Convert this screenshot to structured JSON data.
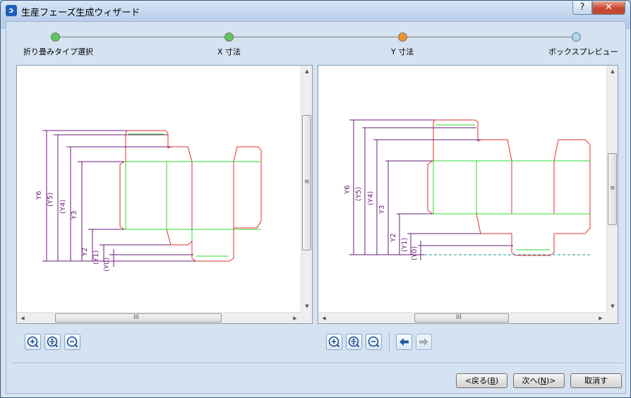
{
  "window": {
    "title": "生産フェーズ生成ウィザード",
    "help_label": "?",
    "close_label": "✕"
  },
  "steps": [
    {
      "label": "折り畳みタイプ選択",
      "status": "done",
      "color": "#5cc85c"
    },
    {
      "label": "X 寸法",
      "status": "done",
      "color": "#5cc85c"
    },
    {
      "label": "Y 寸法",
      "status": "current",
      "color": "#f0922a"
    },
    {
      "label": "ボックスプレビュー",
      "status": "pending",
      "color": "#a9d8ef"
    }
  ],
  "left_panel": {
    "dimension_labels": [
      "Y6",
      "(Y5)",
      "(Y4)",
      "Y3",
      "Y2",
      "(Y1)",
      "(Y0)"
    ]
  },
  "right_panel": {
    "dimension_labels": [
      "Y6",
      "(Y5)",
      "(Y4)",
      "Y3",
      "Y2",
      "(Y1)",
      "(Y0)"
    ]
  },
  "scroll_grip": "III",
  "vscroll_grip": "≡",
  "toolbar": {
    "left_icons": [
      "zoom-in-icon",
      "zoom-fit-icon",
      "zoom-out-icon"
    ],
    "right_icons": [
      "zoom-in-icon",
      "zoom-fit-icon",
      "zoom-out-icon",
      "back-arrow-icon",
      "forward-arrow-icon"
    ]
  },
  "buttons": {
    "back_prefix": "<戻る(",
    "back_key": "B",
    "back_suffix": ")",
    "next_prefix": "次へ(",
    "next_key": "N",
    "next_suffix": ")>",
    "cancel": "取消す"
  },
  "colors": {
    "cut_line": "#e03030",
    "fold_line": "#2ed82e",
    "dimension": "#6a1b7a",
    "baseline": "#1a9a9a"
  }
}
